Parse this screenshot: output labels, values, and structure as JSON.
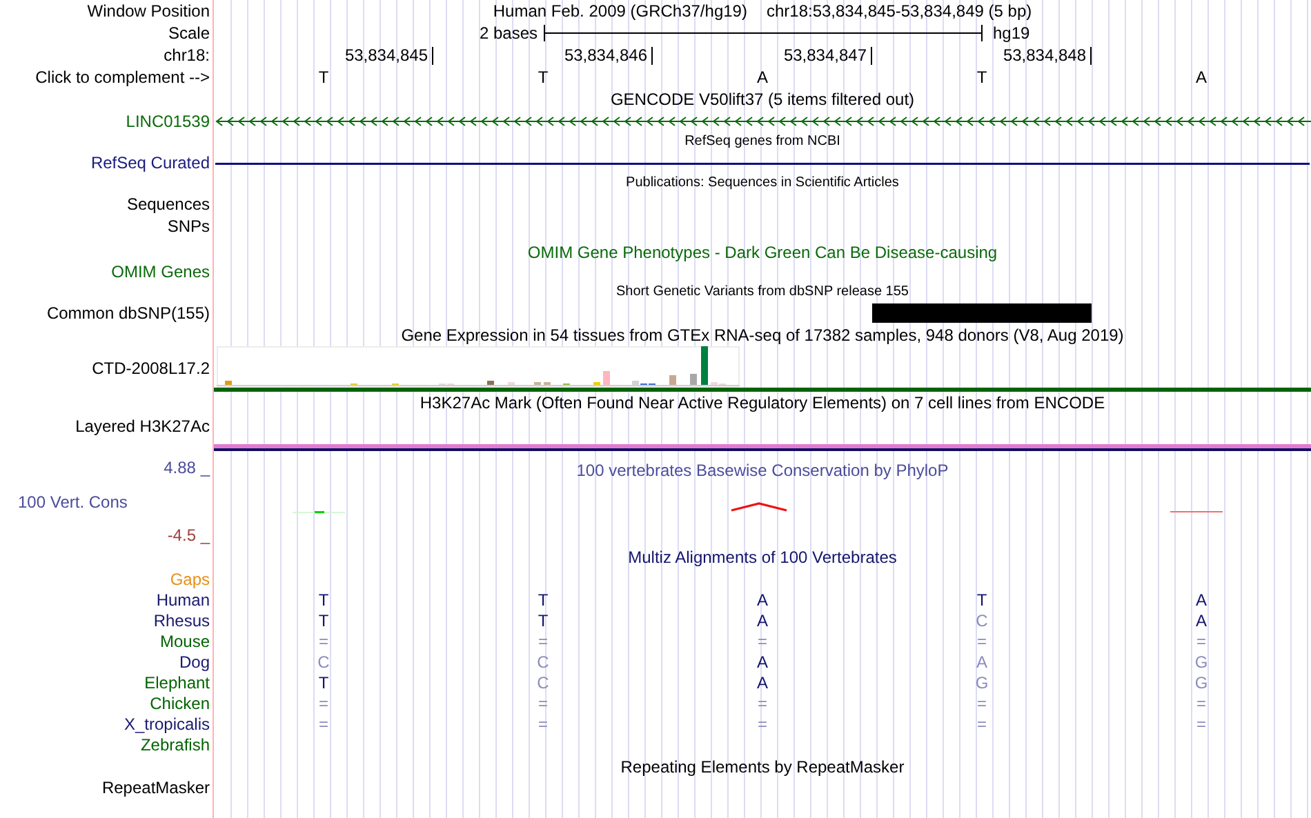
{
  "position": {
    "label": "Window Position",
    "assembly": "Human Feb. 2009 (GRCh37/hg19)",
    "range": "chr18:53,834,845-53,834,849 (5 bp)"
  },
  "scale": {
    "label": "Scale",
    "size": "2 bases",
    "assembly": "hg19"
  },
  "coordinates": {
    "label": "chr18:",
    "ticks": [
      "53,834,845",
      "53,834,846",
      "53,834,847",
      "53,834,848"
    ]
  },
  "sequence": {
    "label": "Click to complement -->",
    "bases": [
      "T",
      "T",
      "A",
      "T",
      "A"
    ]
  },
  "tracks": [
    {
      "kind": "gencode",
      "title": "GENCODE V50lift37 (5 items filtered out)",
      "label": "LINC01539"
    },
    {
      "kind": "refseq",
      "title": "RefSeq genes from NCBI",
      "label": "RefSeq Curated"
    },
    {
      "kind": "publications",
      "title": "Publications: Sequences in Scientific Articles",
      "labels": [
        "Sequences",
        "SNPs"
      ]
    },
    {
      "kind": "omim",
      "title": "OMIM Gene Phenotypes - Dark Green Can Be Disease-causing",
      "label": "OMIM Genes"
    },
    {
      "kind": "snp",
      "title": "Short Genetic Variants from dbSNP release 155",
      "label": "Common dbSNP(155)",
      "covered": [
        false,
        false,
        false,
        true,
        false
      ]
    },
    {
      "kind": "gtex",
      "title": "Gene Expression in 54 tissues from GTEx RNA-seq of 17382 samples, 948 donors (V8, Aug 2019)",
      "label": "CTD-2008L17.2"
    },
    {
      "kind": "h3k27ac",
      "title": "H3K27Ac Mark (Often Found Near Active Regulatory Elements) on 7 cell lines from ENCODE",
      "label": "Layered H3K27Ac"
    },
    {
      "kind": "phylop",
      "title": "100 vertebrates Basewise Conservation by PhyloP",
      "label": "100 Vert. Cons",
      "max": "4.88 _",
      "min": "-4.5 _"
    },
    {
      "kind": "multiz",
      "title": "Multiz Alignments of 100 Vertebrates",
      "gaps_label": "Gaps",
      "species": [
        {
          "name": "Human",
          "color": "#191970",
          "bases": [
            {
              "base": "T",
              "matches": true
            },
            {
              "base": "T",
              "matches": true
            },
            {
              "base": "A",
              "matches": true
            },
            {
              "base": "T",
              "matches": true
            },
            {
              "base": "A",
              "matches": true
            }
          ]
        },
        {
          "name": "Rhesus",
          "color": "#191970",
          "bases": [
            {
              "base": "T",
              "matches": true
            },
            {
              "base": "T",
              "matches": true
            },
            {
              "base": "A",
              "matches": true
            },
            {
              "base": "C",
              "matches": false
            },
            {
              "base": "A",
              "matches": true
            }
          ]
        },
        {
          "name": "Mouse",
          "color": "#006400",
          "bases": [
            {
              "base": "=",
              "matches": false
            },
            {
              "base": "=",
              "matches": false
            },
            {
              "base": "=",
              "matches": false
            },
            {
              "base": "=",
              "matches": false
            },
            {
              "base": "=",
              "matches": false
            }
          ]
        },
        {
          "name": "Dog",
          "color": "#191970",
          "bases": [
            {
              "base": "C",
              "matches": false
            },
            {
              "base": "C",
              "matches": false
            },
            {
              "base": "A",
              "matches": true
            },
            {
              "base": "A",
              "matches": false
            },
            {
              "base": "G",
              "matches": false
            }
          ]
        },
        {
          "name": "Elephant",
          "color": "#006400",
          "bases": [
            {
              "base": "T",
              "matches": true
            },
            {
              "base": "C",
              "matches": false
            },
            {
              "base": "A",
              "matches": true
            },
            {
              "base": "G",
              "matches": false
            },
            {
              "base": "G",
              "matches": false
            }
          ]
        },
        {
          "name": "Chicken",
          "color": "#006400",
          "bases": [
            {
              "base": "=",
              "matches": false
            },
            {
              "base": "=",
              "matches": false
            },
            {
              "base": "=",
              "matches": false
            },
            {
              "base": "=",
              "matches": false
            },
            {
              "base": "=",
              "matches": false
            }
          ]
        },
        {
          "name": "X_tropicalis",
          "color": "#191970",
          "bases": [
            {
              "base": "=",
              "matches": false
            },
            {
              "base": "=",
              "matches": false
            },
            {
              "base": "=",
              "matches": false
            },
            {
              "base": "=",
              "matches": false
            },
            {
              "base": "=",
              "matches": false
            }
          ]
        },
        {
          "name": "Zebrafish",
          "color": "#006400"
        }
      ]
    },
    {
      "kind": "rmsk",
      "title": "Repeating Elements by RepeatMasker",
      "label": "RepeatMasker"
    }
  ]
}
